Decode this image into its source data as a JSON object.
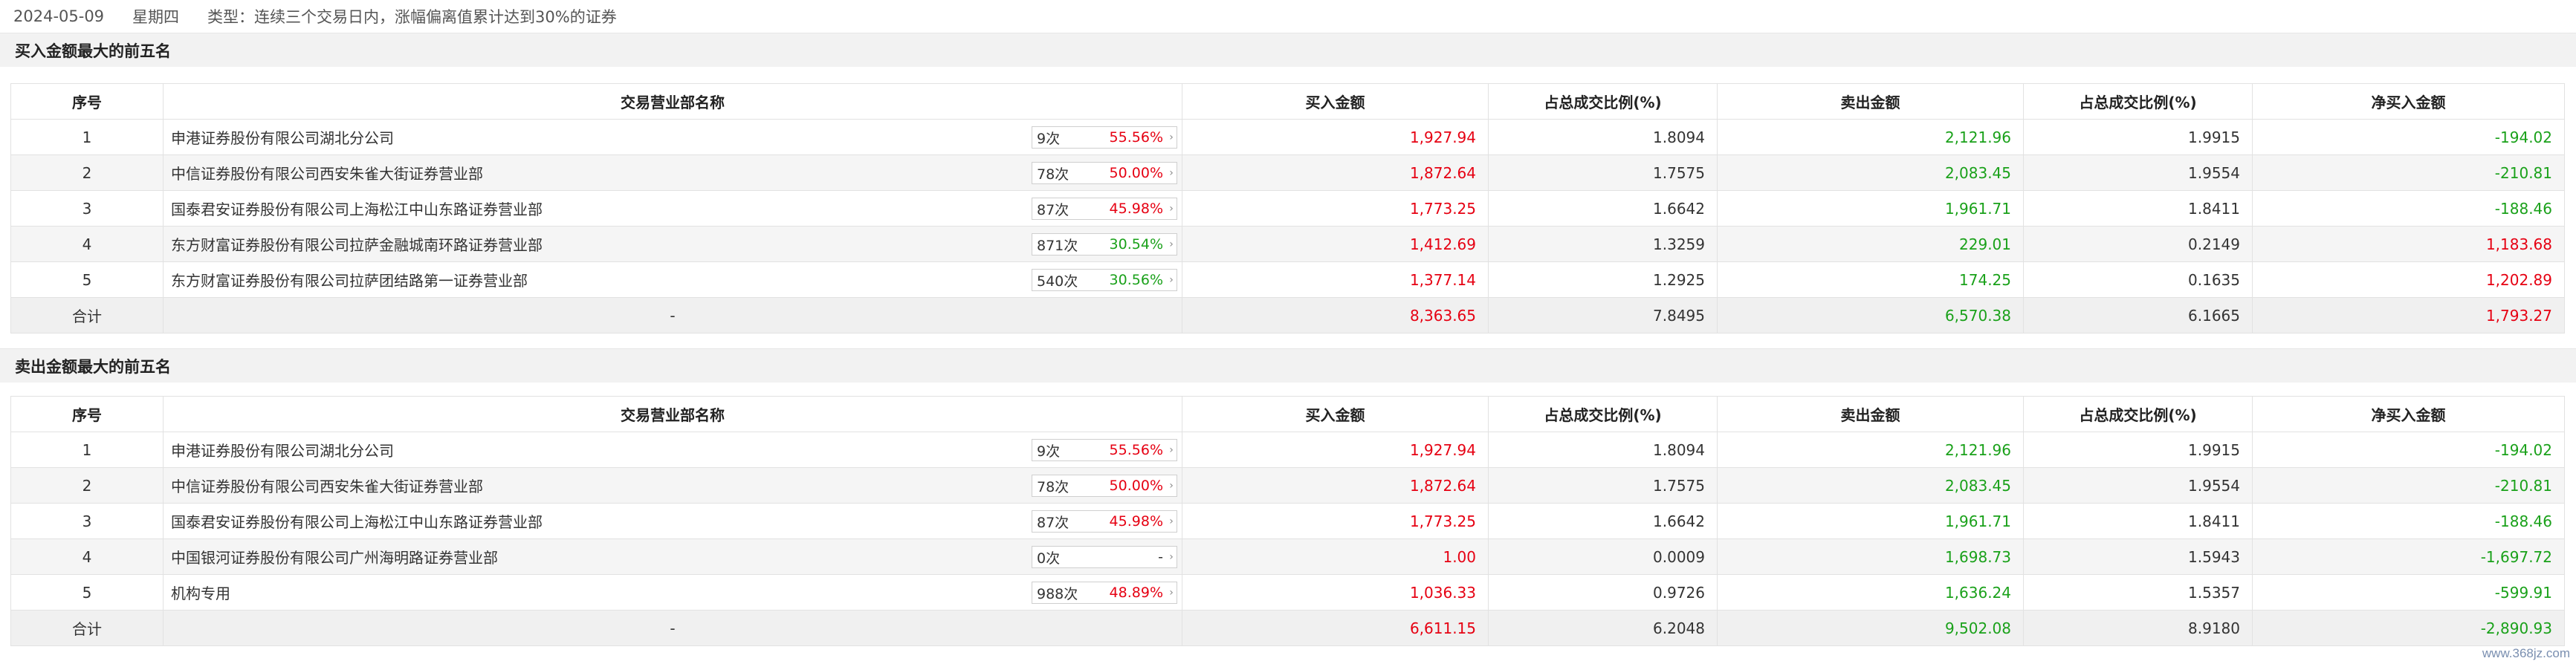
{
  "header": {
    "date": "2024-05-09",
    "weekday": "星期四",
    "type_text": "类型：连续三个交易日内，涨幅偏离值累计达到30%的证券"
  },
  "columns": [
    "序号",
    "交易营业部名称",
    "买入金额",
    "占总成交比例(%)",
    "卖出金额",
    "占总成交比例(%)",
    "净买入金额"
  ],
  "buy_section": {
    "title": "买入金额最大的前五名",
    "rows": [
      {
        "no": "1",
        "name": "申港证券股份有限公司湖北分公司",
        "count": "9次",
        "rate": "55.56%",
        "buy": "1,927.94",
        "buy_pct": "1.8094",
        "sell": "2,121.96",
        "sell_pct": "1.9915",
        "net": "-194.02"
      },
      {
        "no": "2",
        "name": "中信证券股份有限公司西安朱雀大街证券营业部",
        "count": "78次",
        "rate": "50.00%",
        "buy": "1,872.64",
        "buy_pct": "1.7575",
        "sell": "2,083.45",
        "sell_pct": "1.9554",
        "net": "-210.81"
      },
      {
        "no": "3",
        "name": "国泰君安证券股份有限公司上海松江中山东路证券营业部",
        "count": "87次",
        "rate": "45.98%",
        "buy": "1,773.25",
        "buy_pct": "1.6642",
        "sell": "1,961.71",
        "sell_pct": "1.8411",
        "net": "-188.46"
      },
      {
        "no": "4",
        "name": "东方财富证券股份有限公司拉萨金融城南环路证券营业部",
        "count": "871次",
        "rate": "30.54%",
        "buy": "1,412.69",
        "buy_pct": "1.3259",
        "sell": "229.01",
        "sell_pct": "0.2149",
        "net": "1,183.68"
      },
      {
        "no": "5",
        "name": "东方财富证券股份有限公司拉萨团结路第一证券营业部",
        "count": "540次",
        "rate": "30.56%",
        "buy": "1,377.14",
        "buy_pct": "1.2925",
        "sell": "174.25",
        "sell_pct": "0.1635",
        "net": "1,202.89"
      }
    ],
    "total": {
      "label": "合计",
      "name": "-",
      "buy": "8,363.65",
      "buy_pct": "7.8495",
      "sell": "6,570.38",
      "sell_pct": "6.1665",
      "net": "1,793.27"
    }
  },
  "sell_section": {
    "title": "卖出金额最大的前五名",
    "rows": [
      {
        "no": "1",
        "name": "申港证券股份有限公司湖北分公司",
        "count": "9次",
        "rate": "55.56%",
        "buy": "1,927.94",
        "buy_pct": "1.8094",
        "sell": "2,121.96",
        "sell_pct": "1.9915",
        "net": "-194.02"
      },
      {
        "no": "2",
        "name": "中信证券股份有限公司西安朱雀大街证券营业部",
        "count": "78次",
        "rate": "50.00%",
        "buy": "1,872.64",
        "buy_pct": "1.7575",
        "sell": "2,083.45",
        "sell_pct": "1.9554",
        "net": "-210.81"
      },
      {
        "no": "3",
        "name": "国泰君安证券股份有限公司上海松江中山东路证券营业部",
        "count": "87次",
        "rate": "45.98%",
        "buy": "1,773.25",
        "buy_pct": "1.6642",
        "sell": "1,961.71",
        "sell_pct": "1.8411",
        "net": "-188.46"
      },
      {
        "no": "4",
        "name": "中国银河证券股份有限公司广州海明路证券营业部",
        "count": "0次",
        "rate": "-",
        "buy": "1.00",
        "buy_pct": "0.0009",
        "sell": "1,698.73",
        "sell_pct": "1.5943",
        "net": "-1,697.72"
      },
      {
        "no": "5",
        "name": "机构专用",
        "count": "988次",
        "rate": "48.89%",
        "buy": "1,036.33",
        "buy_pct": "0.9726",
        "sell": "1,636.24",
        "sell_pct": "1.5357",
        "net": "-599.91"
      }
    ],
    "total": {
      "label": "合计",
      "name": "-",
      "buy": "6,611.15",
      "buy_pct": "6.2048",
      "sell": "9,502.08",
      "sell_pct": "8.9180",
      "net": "-2,890.93"
    }
  },
  "watermark": "www.368jz.com",
  "colors": {
    "buy": "#e60012",
    "sell": "#1aa11a",
    "net_negative": "#1aa11a",
    "net_positive": "#e60012",
    "rate": "#e60012",
    "rate_low": "#1aa11a"
  },
  "icons": {
    "badge_arrow": "chevron-right-icon"
  }
}
